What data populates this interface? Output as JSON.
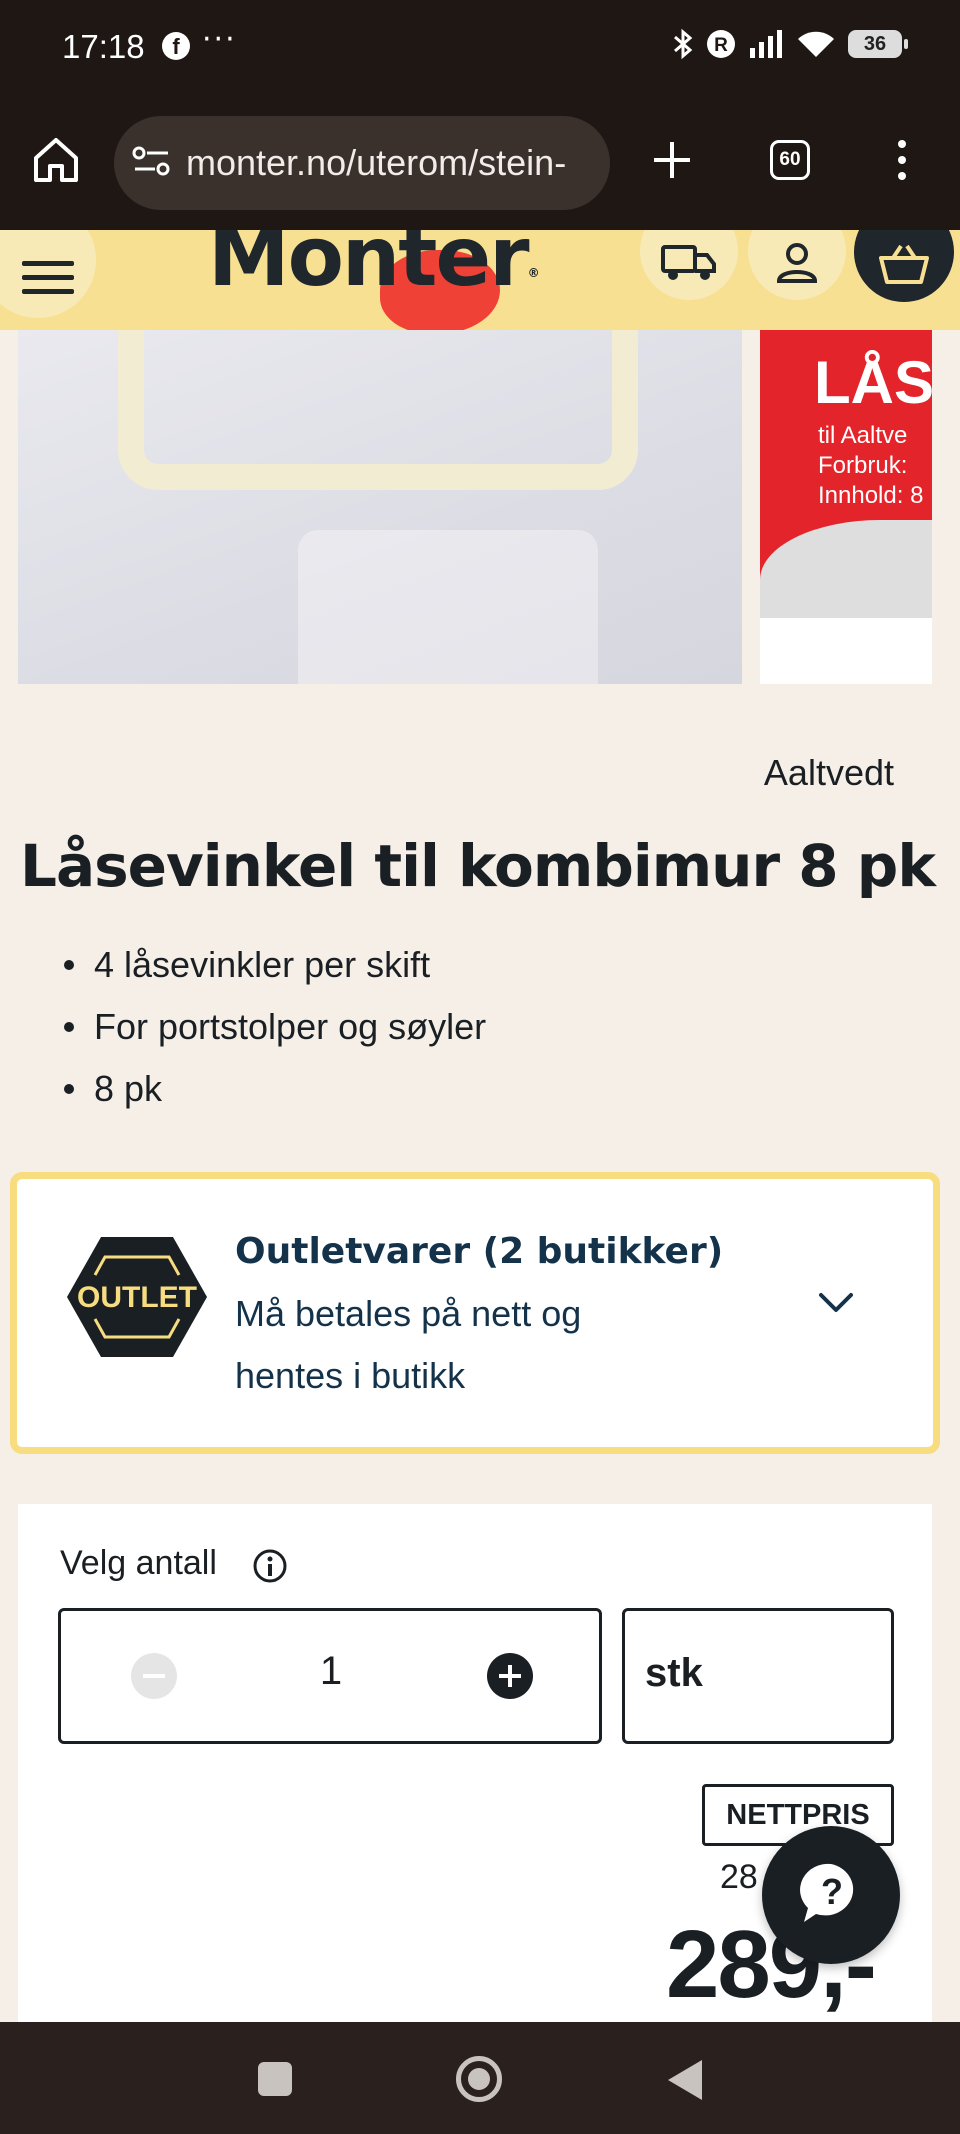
{
  "status_bar": {
    "time": "17:18",
    "notif_icons": [
      "facebook-icon",
      "more-dots-icon"
    ],
    "dots": "···",
    "system_icons": [
      "bluetooth-icon",
      "r-badge-icon",
      "signal-icon",
      "wifi-icon",
      "battery-icon"
    ],
    "r_badge": "R",
    "battery": "36"
  },
  "browser": {
    "url": "monter.no/uterom/stein-",
    "tab_count": "60"
  },
  "site_header": {
    "logo": "Monter",
    "logo_reg": "®",
    "icons": [
      "menu-icon",
      "truck-icon",
      "user-icon",
      "cart-icon"
    ],
    "colors": {
      "header_bg": "#f7e091",
      "logo_accent": "#ef4135",
      "cart_bg": "#1f262c"
    }
  },
  "gallery": {
    "next_image_title": "LÅS",
    "next_image_lines": [
      "til Aaltve",
      "Forbruk: ",
      "Innhold: 8"
    ]
  },
  "product": {
    "brand": "Aaltvedt",
    "title": "Låsevinkel til kombimur 8 pk",
    "bullets": [
      "4 låsevinkler per skift",
      "For portstolper og søyler",
      "8 pk"
    ]
  },
  "outlet": {
    "badge_text": "OUTLET",
    "title": "Outletvarer (2 butikker)",
    "description": "Må betales på nett og hentes i butikk",
    "colors": {
      "border": "#f7dd80",
      "text": "#14334a",
      "badge_bg": "#1a1f24",
      "badge_fg": "#f7dd80"
    }
  },
  "purchase": {
    "quantity_label": "Velg antall",
    "quantity_value": "1",
    "unit": "stk",
    "price_badge": "NETTPRIS",
    "old_price_partial": "28",
    "price": "289,-"
  },
  "nav_bar": {
    "icons": [
      "recents-icon",
      "home-circle-icon",
      "back-icon"
    ]
  }
}
